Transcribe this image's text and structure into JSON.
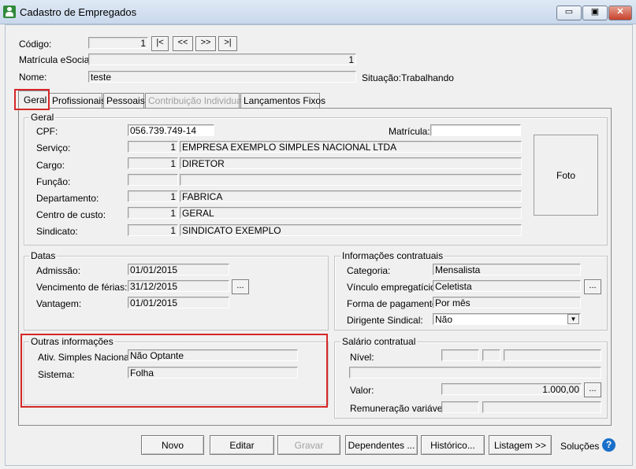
{
  "window": {
    "title": "Cadastro de Empregados",
    "min": "▭",
    "max": "▣",
    "close": "✕"
  },
  "top": {
    "codigo_label": "Código:",
    "codigo_value": "1",
    "nav": [
      "|<",
      "<<",
      ">>",
      ">|"
    ],
    "matricula_esocial_label": "Matrícula eSocial:",
    "matricula_esocial_value": "1",
    "nome_label": "Nome:",
    "nome_value": "teste",
    "situacao_label": "Situação:",
    "situacao_value": "Trabalhando"
  },
  "tabs": [
    "Geral",
    "Profissionais",
    "Pessoais",
    "Contribuição Individual",
    "Lançamentos Fixos"
  ],
  "geral": {
    "title": "Geral",
    "cpf_label": "CPF:",
    "cpf_value": "056.739.749-14",
    "matricula_label": "Matrícula:",
    "matricula_value": "",
    "servico_label": "Serviço:",
    "servico_code": "1",
    "servico_name": "EMPRESA EXEMPLO SIMPLES NACIONAL LTDA",
    "cargo_label": "Cargo:",
    "cargo_code": "1",
    "cargo_name": "DIRETOR",
    "funcao_label": "Função:",
    "funcao_code": "",
    "funcao_name": "",
    "departamento_label": "Departamento:",
    "departamento_code": "1",
    "departamento_name": "FABRICA",
    "centro_label": "Centro de custo:",
    "centro_code": "1",
    "centro_name": "GERAL",
    "sindicato_label": "Sindicato:",
    "sindicato_code": "1",
    "sindicato_name": "SINDICATO EXEMPLO",
    "foto_label": "Foto"
  },
  "datas": {
    "title": "Datas",
    "admissao_label": "Admissão:",
    "admissao_value": "01/01/2015",
    "vencimento_label": "Vencimento de férias:",
    "vencimento_value": "31/12/2015",
    "vantagem_label": "Vantagem:",
    "vantagem_value": "01/01/2015",
    "ellipsis": "..."
  },
  "contratuais": {
    "title": "Informações contratuais",
    "categoria_label": "Categoria:",
    "categoria_value": "Mensalista",
    "vinculo_label": "Vínculo empregatício:",
    "vinculo_value": "Celetista",
    "forma_label": "Forma de pagamento:",
    "forma_value": "Por mês",
    "dirigente_label": "Dirigente Sindical:",
    "dirigente_value": "Não",
    "ellipsis": "..."
  },
  "outras": {
    "title": "Outras informações",
    "ativ_label": "Ativ. Simples Nacional:",
    "ativ_value": "Não Optante",
    "sistema_label": "Sistema:",
    "sistema_value": "Folha"
  },
  "salario": {
    "title": "Salário contratual",
    "nivel_label": "Nível:",
    "valor_label": "Valor:",
    "valor_value": "1.000,00",
    "remuneracao_label": "Remuneração variável:",
    "ellipsis": "..."
  },
  "buttons": {
    "novo": "Novo",
    "editar": "Editar",
    "gravar": "Gravar",
    "dependentes": "Dependentes ...",
    "historico": "Histórico...",
    "listagem": "Listagem >>",
    "solucoes": "Soluções",
    "help": "?"
  }
}
